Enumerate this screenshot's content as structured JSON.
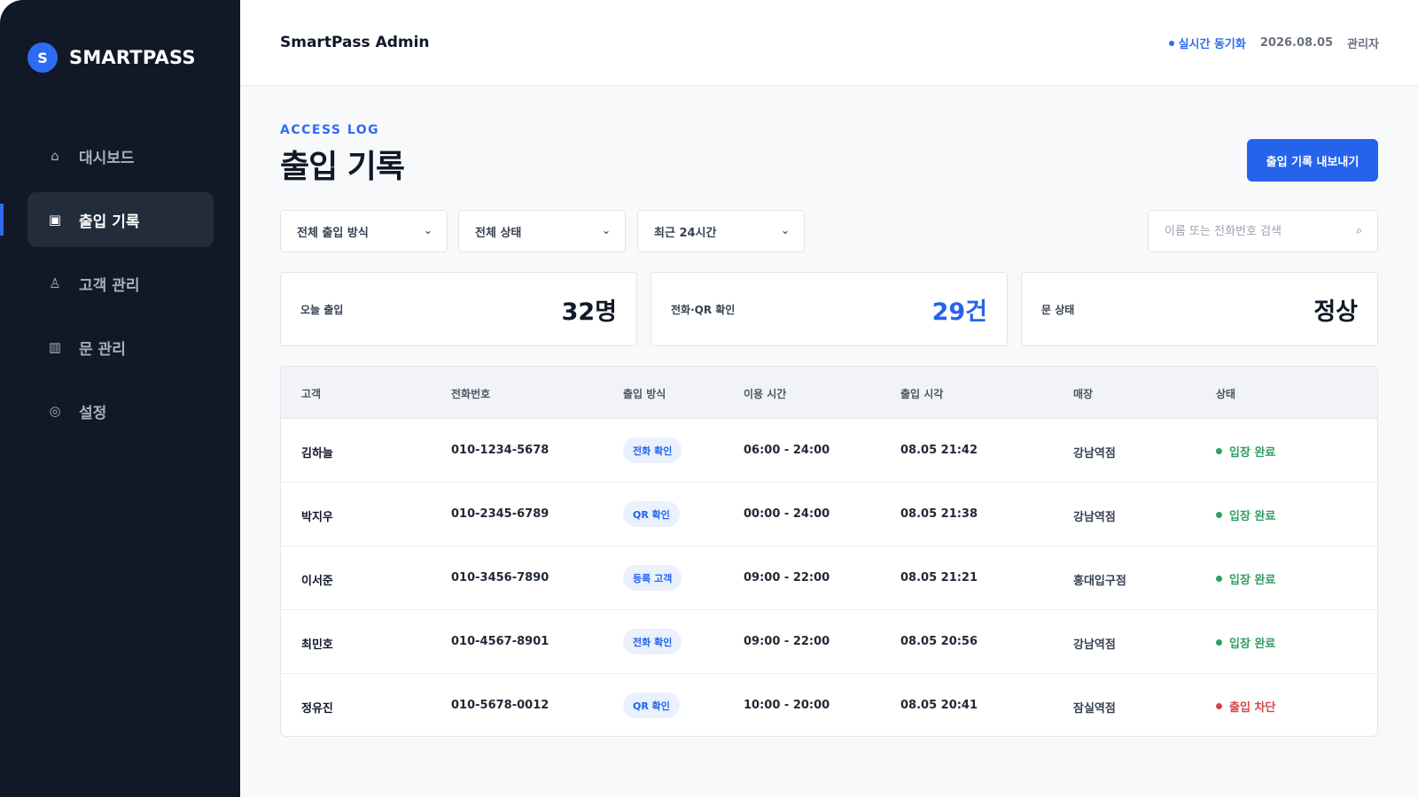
{
  "brand": {
    "logo_letter": "S",
    "name": "SMARTPASS"
  },
  "nav": [
    {
      "icon": "home-icon",
      "glyph": "⌂",
      "label": "대시보드",
      "active": false
    },
    {
      "icon": "log-icon",
      "glyph": "▣",
      "label": "출입 기록",
      "active": true
    },
    {
      "icon": "person-icon",
      "glyph": "♙",
      "label": "고객 관리",
      "active": false
    },
    {
      "icon": "door-icon",
      "glyph": "▥",
      "label": "문 관리",
      "active": false
    },
    {
      "icon": "settings-icon",
      "glyph": "◎",
      "label": "설정",
      "active": false
    }
  ],
  "header": {
    "title": "SmartPass Admin",
    "sync_label": "실시간 동기화",
    "date": "2026.08.05",
    "user": "관리자"
  },
  "page": {
    "eyebrow": "ACCESS LOG",
    "title": "출입 기록",
    "export_label": "출입 기록 내보내기"
  },
  "filters": {
    "method": "전체 출입 방식",
    "status": "전체 상태",
    "period": "최근 24시간",
    "search_placeholder": "이름 또는 전화번호 검색",
    "chevron": "⌄",
    "search_glyph": "⌕"
  },
  "stats": [
    {
      "label": "오늘 출입",
      "value": "32명",
      "highlight": false
    },
    {
      "label": "전화·QR 확인",
      "value": "29건",
      "highlight": true
    },
    {
      "label": "문 상태",
      "value": "정상",
      "highlight": false
    }
  ],
  "table": {
    "columns": [
      "고객",
      "전화번호",
      "출입 방식",
      "이용 시간",
      "출입 시각",
      "매장",
      "상태"
    ],
    "rows": [
      {
        "name": "김하늘",
        "phone": "010-1234-5678",
        "method": "전화 확인",
        "hours": "06:00 - 24:00",
        "time": "08.05 21:42",
        "store": "강남역점",
        "status": "입장 완료",
        "status_color": "#2f9e63"
      },
      {
        "name": "박지우",
        "phone": "010-2345-6789",
        "method": "QR 확인",
        "hours": "00:00 - 24:00",
        "time": "08.05 21:38",
        "store": "강남역점",
        "status": "입장 완료",
        "status_color": "#2f9e63"
      },
      {
        "name": "이서준",
        "phone": "010-3456-7890",
        "method": "등록 고객",
        "hours": "09:00 - 22:00",
        "time": "08.05 21:21",
        "store": "홍대입구점",
        "status": "입장 완료",
        "status_color": "#2f9e63"
      },
      {
        "name": "최민호",
        "phone": "010-4567-8901",
        "method": "전화 확인",
        "hours": "09:00 - 22:00",
        "time": "08.05 20:56",
        "store": "강남역점",
        "status": "입장 완료",
        "status_color": "#2f9e63"
      },
      {
        "name": "정유진",
        "phone": "010-5678-0012",
        "method": "QR 확인",
        "hours": "10:00 - 20:00",
        "time": "08.05 20:41",
        "store": "잠실역점",
        "status": "출입 차단",
        "status_color": "#d64545"
      }
    ]
  },
  "colors": {
    "accent": "#2563eb",
    "sidebar": "#111827",
    "success": "#2f9e63",
    "danger": "#d64545"
  }
}
